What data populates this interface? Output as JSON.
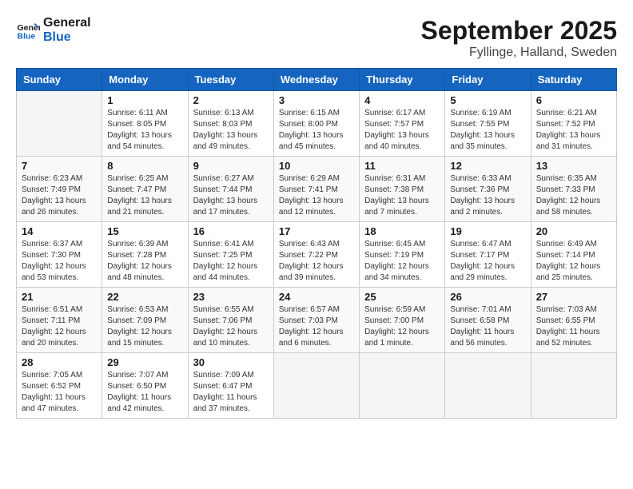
{
  "header": {
    "logo_line1": "General",
    "logo_line2": "Blue",
    "month_title": "September 2025",
    "subtitle": "Fyllinge, Halland, Sweden"
  },
  "weekdays": [
    "Sunday",
    "Monday",
    "Tuesday",
    "Wednesday",
    "Thursday",
    "Friday",
    "Saturday"
  ],
  "weeks": [
    [
      {
        "day": "",
        "sunrise": "",
        "sunset": "",
        "daylight": ""
      },
      {
        "day": "1",
        "sunrise": "Sunrise: 6:11 AM",
        "sunset": "Sunset: 8:05 PM",
        "daylight": "Daylight: 13 hours and 54 minutes."
      },
      {
        "day": "2",
        "sunrise": "Sunrise: 6:13 AM",
        "sunset": "Sunset: 8:03 PM",
        "daylight": "Daylight: 13 hours and 49 minutes."
      },
      {
        "day": "3",
        "sunrise": "Sunrise: 6:15 AM",
        "sunset": "Sunset: 8:00 PM",
        "daylight": "Daylight: 13 hours and 45 minutes."
      },
      {
        "day": "4",
        "sunrise": "Sunrise: 6:17 AM",
        "sunset": "Sunset: 7:57 PM",
        "daylight": "Daylight: 13 hours and 40 minutes."
      },
      {
        "day": "5",
        "sunrise": "Sunrise: 6:19 AM",
        "sunset": "Sunset: 7:55 PM",
        "daylight": "Daylight: 13 hours and 35 minutes."
      },
      {
        "day": "6",
        "sunrise": "Sunrise: 6:21 AM",
        "sunset": "Sunset: 7:52 PM",
        "daylight": "Daylight: 13 hours and 31 minutes."
      }
    ],
    [
      {
        "day": "7",
        "sunrise": "Sunrise: 6:23 AM",
        "sunset": "Sunset: 7:49 PM",
        "daylight": "Daylight: 13 hours and 26 minutes."
      },
      {
        "day": "8",
        "sunrise": "Sunrise: 6:25 AM",
        "sunset": "Sunset: 7:47 PM",
        "daylight": "Daylight: 13 hours and 21 minutes."
      },
      {
        "day": "9",
        "sunrise": "Sunrise: 6:27 AM",
        "sunset": "Sunset: 7:44 PM",
        "daylight": "Daylight: 13 hours and 17 minutes."
      },
      {
        "day": "10",
        "sunrise": "Sunrise: 6:29 AM",
        "sunset": "Sunset: 7:41 PM",
        "daylight": "Daylight: 13 hours and 12 minutes."
      },
      {
        "day": "11",
        "sunrise": "Sunrise: 6:31 AM",
        "sunset": "Sunset: 7:38 PM",
        "daylight": "Daylight: 13 hours and 7 minutes."
      },
      {
        "day": "12",
        "sunrise": "Sunrise: 6:33 AM",
        "sunset": "Sunset: 7:36 PM",
        "daylight": "Daylight: 13 hours and 2 minutes."
      },
      {
        "day": "13",
        "sunrise": "Sunrise: 6:35 AM",
        "sunset": "Sunset: 7:33 PM",
        "daylight": "Daylight: 12 hours and 58 minutes."
      }
    ],
    [
      {
        "day": "14",
        "sunrise": "Sunrise: 6:37 AM",
        "sunset": "Sunset: 7:30 PM",
        "daylight": "Daylight: 12 hours and 53 minutes."
      },
      {
        "day": "15",
        "sunrise": "Sunrise: 6:39 AM",
        "sunset": "Sunset: 7:28 PM",
        "daylight": "Daylight: 12 hours and 48 minutes."
      },
      {
        "day": "16",
        "sunrise": "Sunrise: 6:41 AM",
        "sunset": "Sunset: 7:25 PM",
        "daylight": "Daylight: 12 hours and 44 minutes."
      },
      {
        "day": "17",
        "sunrise": "Sunrise: 6:43 AM",
        "sunset": "Sunset: 7:22 PM",
        "daylight": "Daylight: 12 hours and 39 minutes."
      },
      {
        "day": "18",
        "sunrise": "Sunrise: 6:45 AM",
        "sunset": "Sunset: 7:19 PM",
        "daylight": "Daylight: 12 hours and 34 minutes."
      },
      {
        "day": "19",
        "sunrise": "Sunrise: 6:47 AM",
        "sunset": "Sunset: 7:17 PM",
        "daylight": "Daylight: 12 hours and 29 minutes."
      },
      {
        "day": "20",
        "sunrise": "Sunrise: 6:49 AM",
        "sunset": "Sunset: 7:14 PM",
        "daylight": "Daylight: 12 hours and 25 minutes."
      }
    ],
    [
      {
        "day": "21",
        "sunrise": "Sunrise: 6:51 AM",
        "sunset": "Sunset: 7:11 PM",
        "daylight": "Daylight: 12 hours and 20 minutes."
      },
      {
        "day": "22",
        "sunrise": "Sunrise: 6:53 AM",
        "sunset": "Sunset: 7:09 PM",
        "daylight": "Daylight: 12 hours and 15 minutes."
      },
      {
        "day": "23",
        "sunrise": "Sunrise: 6:55 AM",
        "sunset": "Sunset: 7:06 PM",
        "daylight": "Daylight: 12 hours and 10 minutes."
      },
      {
        "day": "24",
        "sunrise": "Sunrise: 6:57 AM",
        "sunset": "Sunset: 7:03 PM",
        "daylight": "Daylight: 12 hours and 6 minutes."
      },
      {
        "day": "25",
        "sunrise": "Sunrise: 6:59 AM",
        "sunset": "Sunset: 7:00 PM",
        "daylight": "Daylight: 12 hours and 1 minute."
      },
      {
        "day": "26",
        "sunrise": "Sunrise: 7:01 AM",
        "sunset": "Sunset: 6:58 PM",
        "daylight": "Daylight: 11 hours and 56 minutes."
      },
      {
        "day": "27",
        "sunrise": "Sunrise: 7:03 AM",
        "sunset": "Sunset: 6:55 PM",
        "daylight": "Daylight: 11 hours and 52 minutes."
      }
    ],
    [
      {
        "day": "28",
        "sunrise": "Sunrise: 7:05 AM",
        "sunset": "Sunset: 6:52 PM",
        "daylight": "Daylight: 11 hours and 47 minutes."
      },
      {
        "day": "29",
        "sunrise": "Sunrise: 7:07 AM",
        "sunset": "Sunset: 6:50 PM",
        "daylight": "Daylight: 11 hours and 42 minutes."
      },
      {
        "day": "30",
        "sunrise": "Sunrise: 7:09 AM",
        "sunset": "Sunset: 6:47 PM",
        "daylight": "Daylight: 11 hours and 37 minutes."
      },
      {
        "day": "",
        "sunrise": "",
        "sunset": "",
        "daylight": ""
      },
      {
        "day": "",
        "sunrise": "",
        "sunset": "",
        "daylight": ""
      },
      {
        "day": "",
        "sunrise": "",
        "sunset": "",
        "daylight": ""
      },
      {
        "day": "",
        "sunrise": "",
        "sunset": "",
        "daylight": ""
      }
    ]
  ]
}
